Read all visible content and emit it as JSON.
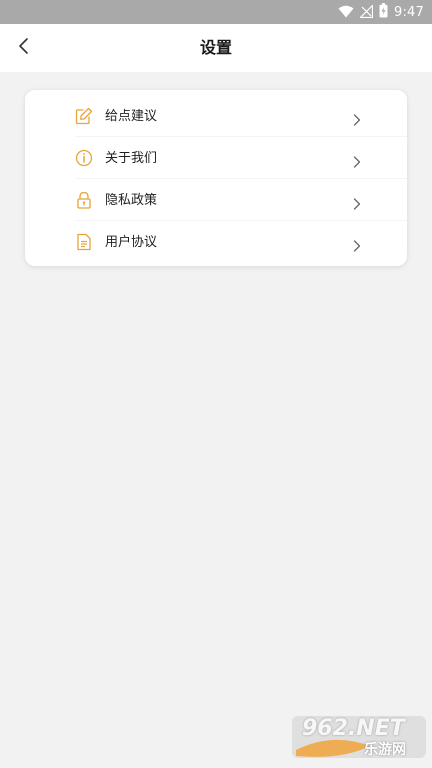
{
  "status_bar": {
    "time": "9:47",
    "icons": [
      "wifi-icon",
      "signal-icon",
      "battery-icon"
    ]
  },
  "header": {
    "title": "设置",
    "back_icon": "chevron-left-icon"
  },
  "menu": {
    "items": [
      {
        "label": "给点建议",
        "icon": "edit-icon"
      },
      {
        "label": "关于我们",
        "icon": "info-icon"
      },
      {
        "label": "隐私政策",
        "icon": "lock-icon"
      },
      {
        "label": "用户协议",
        "icon": "document-icon"
      }
    ],
    "chevron_icon": "chevron-right-icon"
  },
  "watermark": {
    "brand": "962.NET",
    "subtitle": "乐游网"
  },
  "colors": {
    "accent": "#e8a33a",
    "background": "#f2f2f2",
    "status_bar": "#a9a9a9"
  }
}
